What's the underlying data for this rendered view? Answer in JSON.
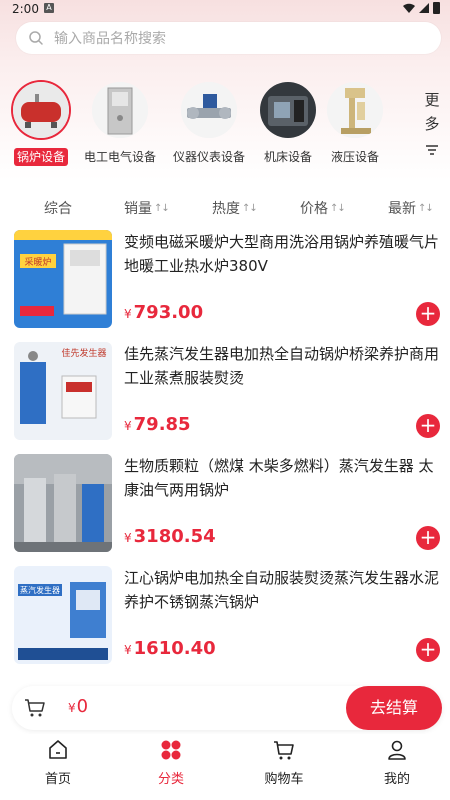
{
  "status": {
    "time": "2:00",
    "notif": "A"
  },
  "search": {
    "placeholder": "输入商品名称搜索"
  },
  "categories": [
    {
      "label": "锅炉设备",
      "icon": "boiler-icon",
      "active": true
    },
    {
      "label": "电工电气设备",
      "icon": "electrical-cabinet-icon",
      "active": false
    },
    {
      "label": "仪器仪表设备",
      "icon": "flow-meter-icon",
      "active": false
    },
    {
      "label": "机床设备",
      "icon": "machine-tool-icon",
      "active": false
    },
    {
      "label": "液压设备",
      "icon": "hydraulic-press-icon",
      "active": false
    }
  ],
  "more": {
    "line1": "更",
    "line2": "多"
  },
  "sort": {
    "comprehensive": "综合",
    "sales": "销量",
    "heat": "热度",
    "price": "价格",
    "newest": "最新",
    "arrows": "↑↓"
  },
  "currency": "¥",
  "products": [
    {
      "title": "变频电磁采暖炉大型商用洗浴用锅炉养殖暖气片地暖工业热水炉380V",
      "price": "793.00",
      "badge": "采暖炉"
    },
    {
      "title": "佳先蒸汽发生器电加热全自动锅炉桥梁养护商用工业蒸煮服装熨烫",
      "price": "79.85",
      "badge": "佳先发生器"
    },
    {
      "title": "生物质颗粒（燃煤 木柴多燃料）蒸汽发生器 太康油气两用锅炉",
      "price": "3180.54",
      "badge": ""
    },
    {
      "title": "江心锅炉电加热全自动服装熨烫蒸汽发生器水泥养护不锈钢蒸汽锅炉",
      "price": "1610.40",
      "badge": "蒸汽发生器"
    }
  ],
  "cart": {
    "total": "0",
    "checkout": "去结算"
  },
  "tabs": [
    {
      "label": "首页",
      "icon": "home-icon",
      "active": false
    },
    {
      "label": "分类",
      "icon": "category-icon",
      "active": true
    },
    {
      "label": "购物车",
      "icon": "cart-icon",
      "active": false
    },
    {
      "label": "我的",
      "icon": "user-icon",
      "active": false
    }
  ],
  "colors": {
    "accent": "#e8283c",
    "header_bg": "#f7e0e0"
  }
}
